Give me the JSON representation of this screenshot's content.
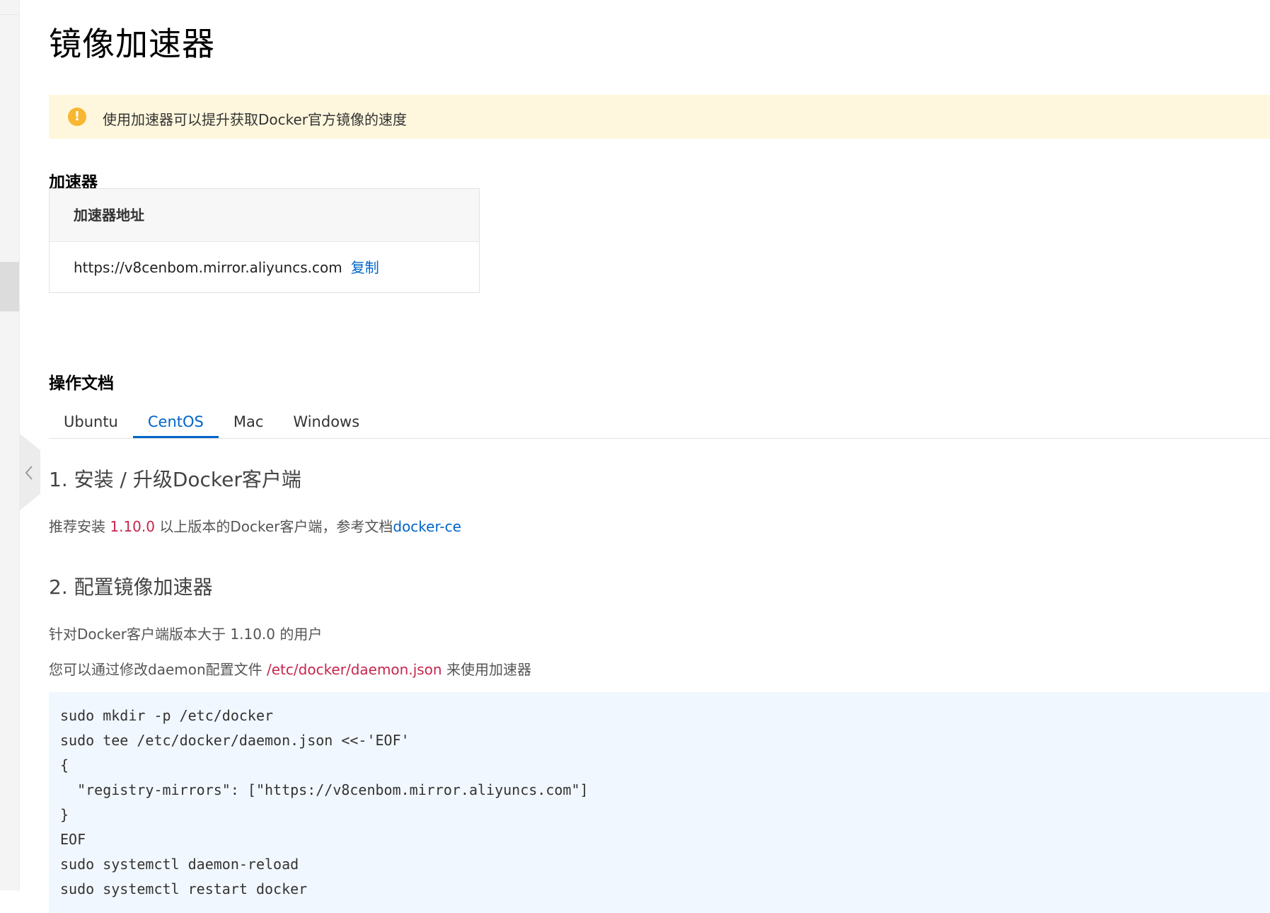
{
  "page": {
    "title": "镜像加速器"
  },
  "notice": {
    "text": "使用加速器可以提升获取Docker官方镜像的速度",
    "icon": "warning-icon"
  },
  "accelerator": {
    "section_title": "加速器",
    "card_header": "加速器地址",
    "address": "https://v8cenbom.mirror.aliyuncs.com",
    "copy_label": "复制"
  },
  "docs": {
    "section_title": "操作文档",
    "tabs": [
      {
        "label": "Ubuntu",
        "active": false
      },
      {
        "label": "CentOS",
        "active": true
      },
      {
        "label": "Mac",
        "active": false
      },
      {
        "label": "Windows",
        "active": false
      }
    ],
    "step1": {
      "heading": "1. 安装 / 升级Docker客户端",
      "text_before": "推荐安装 ",
      "version": "1.10.0",
      "text_after": " 以上版本的Docker客户端，参考文档",
      "link_label": "docker-ce"
    },
    "step2": {
      "heading": "2. 配置镜像加速器",
      "line1": "针对Docker客户端版本大于 1.10.0 的用户",
      "line2_before": "您可以通过修改daemon配置文件 ",
      "config_path": "/etc/docker/daemon.json",
      "line2_after": " 来使用加速器"
    },
    "code_lines": [
      "sudo mkdir -p /etc/docker",
      "sudo tee /etc/docker/daemon.json <<-'EOF'",
      "{",
      "  \"registry-mirrors\": [\"https://v8cenbom.mirror.aliyuncs.com\"]",
      "}",
      "EOF",
      "sudo systemctl daemon-reload",
      "sudo systemctl restart docker"
    ]
  },
  "colors": {
    "link": "#0064c8",
    "highlight": "#c7254e",
    "notice_bg": "#fff7dd",
    "notice_icon": "#f7b731",
    "code_bg": "#f1f7fe"
  }
}
